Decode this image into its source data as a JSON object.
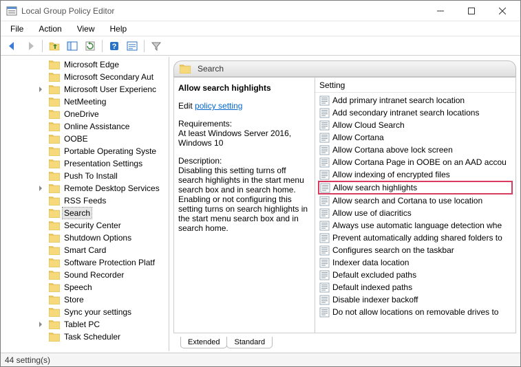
{
  "window": {
    "title": "Local Group Policy Editor"
  },
  "menu": {
    "items": [
      "File",
      "Action",
      "View",
      "Help"
    ]
  },
  "tree": {
    "items": [
      {
        "label": "Microsoft Edge",
        "arrow": false
      },
      {
        "label": "Microsoft Secondary Aut",
        "arrow": false
      },
      {
        "label": "Microsoft User Experienc",
        "arrow": true
      },
      {
        "label": "NetMeeting",
        "arrow": false
      },
      {
        "label": "OneDrive",
        "arrow": false
      },
      {
        "label": "Online Assistance",
        "arrow": false
      },
      {
        "label": "OOBE",
        "arrow": false
      },
      {
        "label": "Portable Operating Syste",
        "arrow": false
      },
      {
        "label": "Presentation Settings",
        "arrow": false
      },
      {
        "label": "Push To Install",
        "arrow": false
      },
      {
        "label": "Remote Desktop Services",
        "arrow": true
      },
      {
        "label": "RSS Feeds",
        "arrow": false
      },
      {
        "label": "Search",
        "arrow": false,
        "selected": true
      },
      {
        "label": "Security Center",
        "arrow": false
      },
      {
        "label": "Shutdown Options",
        "arrow": false
      },
      {
        "label": "Smart Card",
        "arrow": false
      },
      {
        "label": "Software Protection Platf",
        "arrow": false
      },
      {
        "label": "Sound Recorder",
        "arrow": false
      },
      {
        "label": "Speech",
        "arrow": false
      },
      {
        "label": "Store",
        "arrow": false
      },
      {
        "label": "Sync your settings",
        "arrow": false
      },
      {
        "label": "Tablet PC",
        "arrow": true
      },
      {
        "label": "Task Scheduler",
        "arrow": false
      }
    ]
  },
  "header": {
    "title": "Search"
  },
  "detail": {
    "title": "Allow search highlights",
    "edit_label": "Edit",
    "edit_link": "policy setting",
    "requirements_label": "Requirements:",
    "requirements_text": "At least Windows Server 2016, Windows 10",
    "description_label": "Description:",
    "description_text": "Disabling this setting turns off search highlights in the start menu search box and in search home. Enabling or not configuring this setting turns on search highlights in the start menu search box and in search home."
  },
  "settings": {
    "column_header": "Setting",
    "items": [
      {
        "label": "Add primary intranet search location"
      },
      {
        "label": "Add secondary intranet search locations"
      },
      {
        "label": "Allow Cloud Search"
      },
      {
        "label": "Allow Cortana"
      },
      {
        "label": "Allow Cortana above lock screen"
      },
      {
        "label": "Allow Cortana Page in OOBE on an AAD accou"
      },
      {
        "label": "Allow indexing of encrypted files"
      },
      {
        "label": "Allow search highlights",
        "highlighted": true
      },
      {
        "label": "Allow search and Cortana to use location"
      },
      {
        "label": "Allow use of diacritics"
      },
      {
        "label": "Always use automatic language detection whe"
      },
      {
        "label": "Prevent automatically adding shared folders to"
      },
      {
        "label": "Configures search on the taskbar"
      },
      {
        "label": "Indexer data location"
      },
      {
        "label": "Default excluded paths"
      },
      {
        "label": "Default indexed paths"
      },
      {
        "label": "Disable indexer backoff"
      },
      {
        "label": "Do not allow locations on removable drives to"
      }
    ]
  },
  "tabs": {
    "items": [
      "Extended",
      "Standard"
    ]
  },
  "status": {
    "text": "44 setting(s)"
  }
}
